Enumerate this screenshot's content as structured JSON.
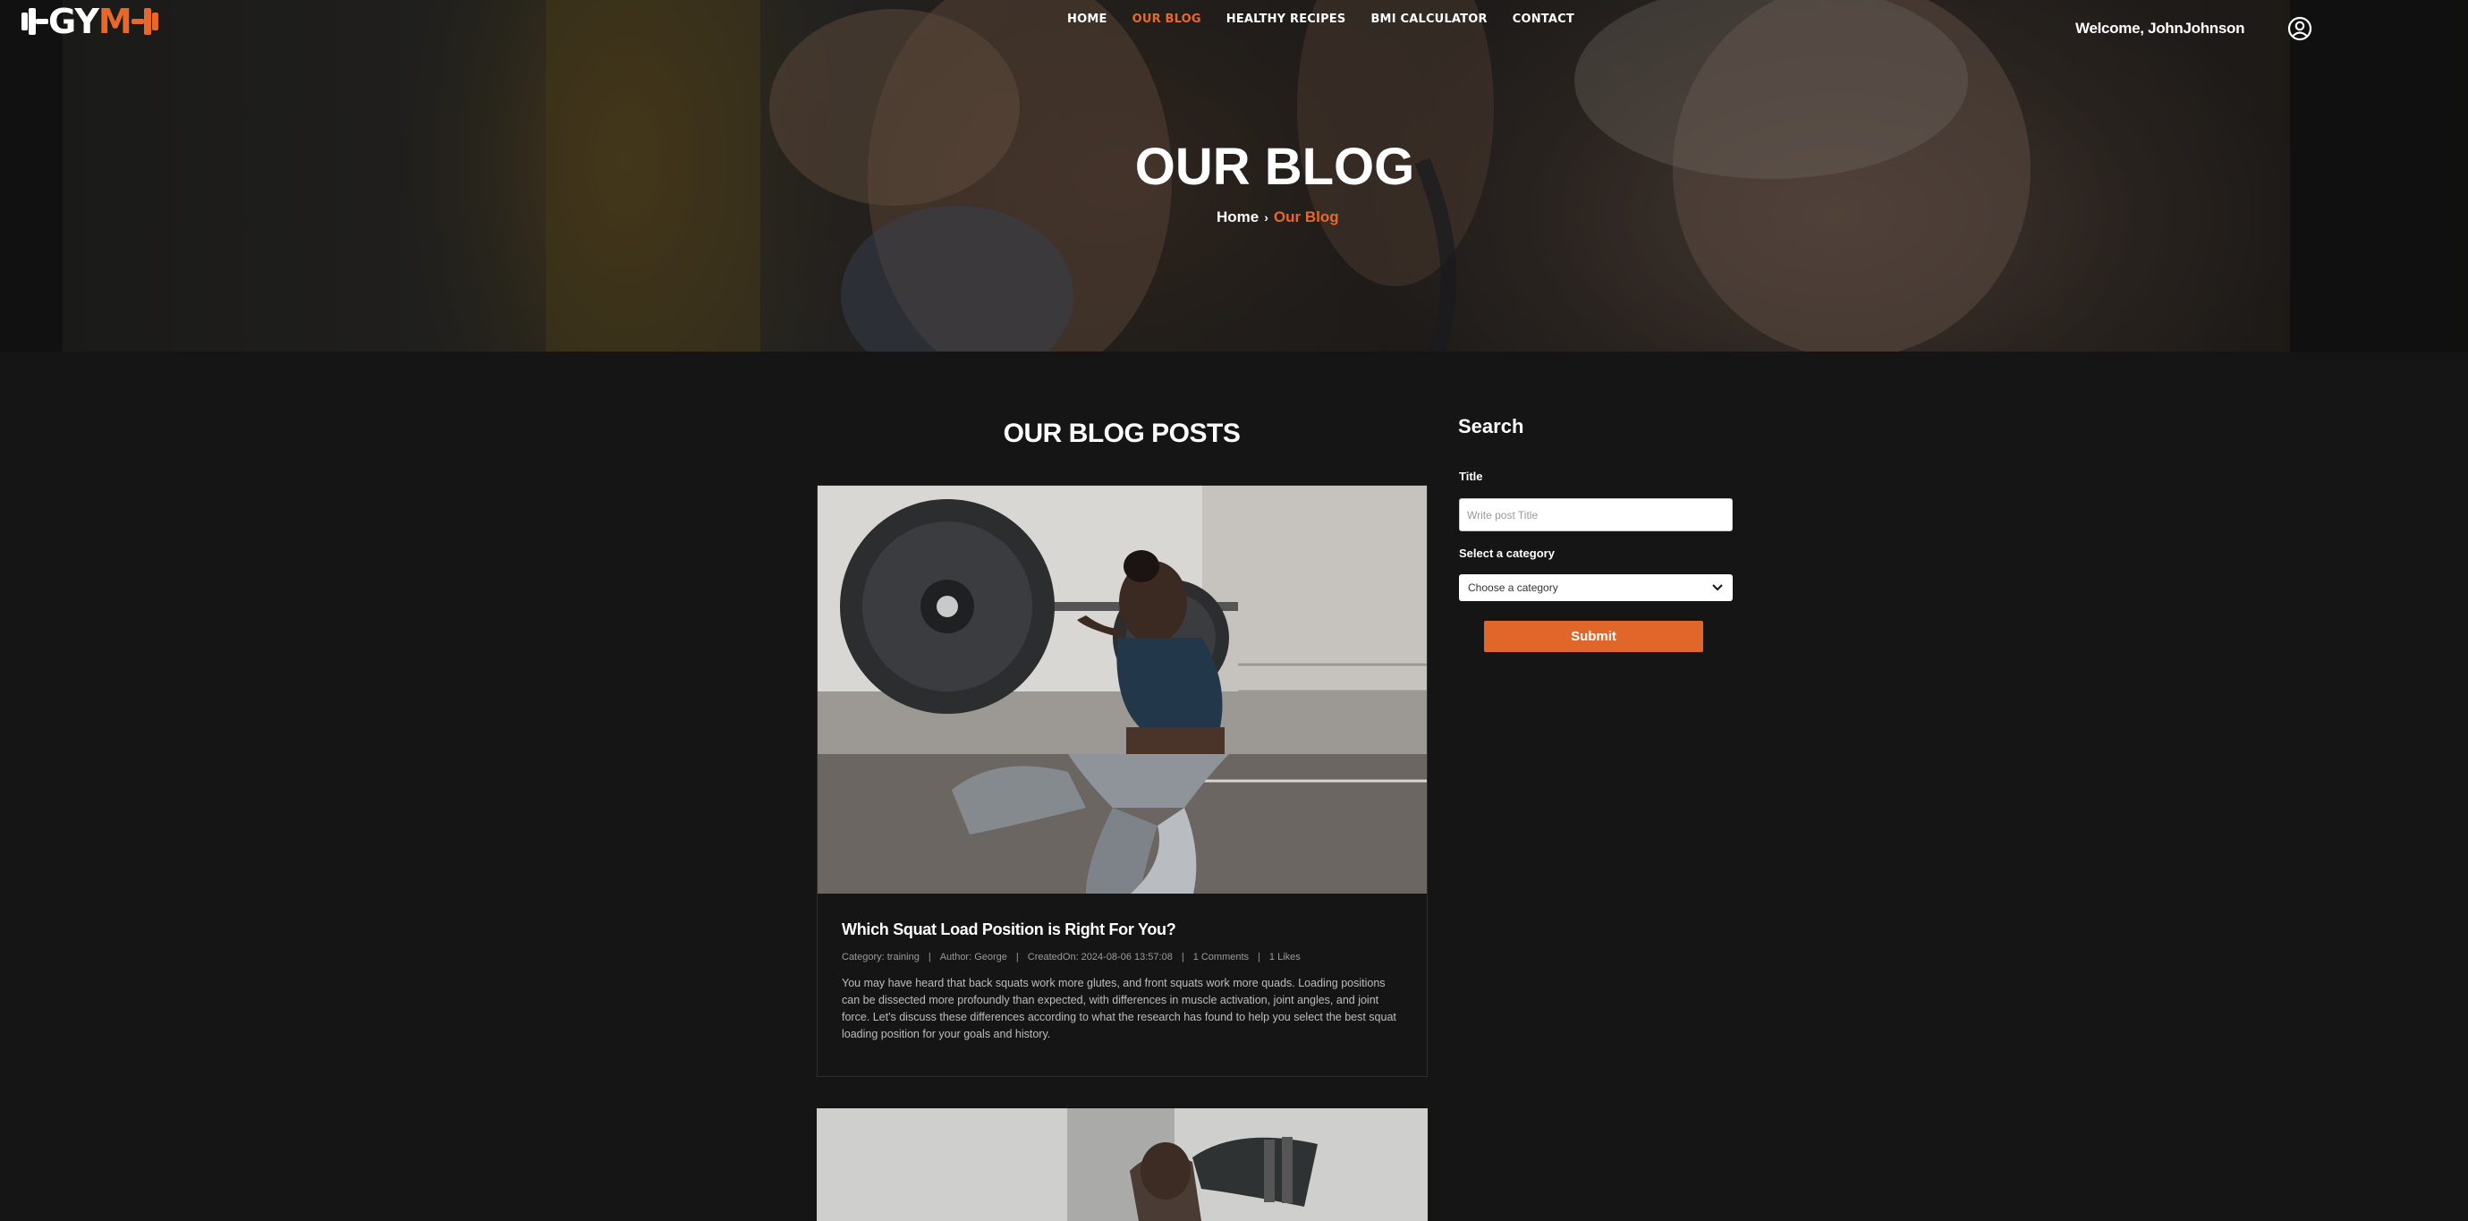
{
  "brand": {
    "logo_left": "GY",
    "logo_right": "M",
    "accent": "#e8682a"
  },
  "nav": {
    "items": [
      {
        "label": "HOME"
      },
      {
        "label": "OUR BLOG"
      },
      {
        "label": "HEALTHY RECIPES"
      },
      {
        "label": "BMI CALCULATOR"
      },
      {
        "label": "CONTACT"
      }
    ],
    "active_index": 1
  },
  "user": {
    "welcome": "Welcome, JohnJohnson",
    "icon": "user-circle-icon"
  },
  "hero": {
    "title": "OUR BLOG",
    "breadcrumb": {
      "home": "Home",
      "separator": "›",
      "current": "Our Blog"
    }
  },
  "main": {
    "section_title": "OUR BLOG POSTS",
    "posts": [
      {
        "title": "Which Squat Load Position is Right For You?",
        "meta": {
          "category": "Category: training",
          "author": "Author: George",
          "created": "CreatedOn: 2024-08-06 13:57:08",
          "comments": "1 Comments",
          "likes": "1 Likes"
        },
        "excerpt": "You may have heard that back squats work more glutes, and front squats work more quads. Loading positions can be dissected more profoundly than expected, with differences in muscle activation, joint angles, and joint force. Let's discuss these differences according to what the research has found to help you select the best squat loading position for your goals and history."
      }
    ]
  },
  "sidebar": {
    "title": "Search",
    "title_label": "Title",
    "title_placeholder": "Write post Title",
    "category_label": "Select a category",
    "category_selected": "Choose a category",
    "submit_label": "Submit"
  }
}
